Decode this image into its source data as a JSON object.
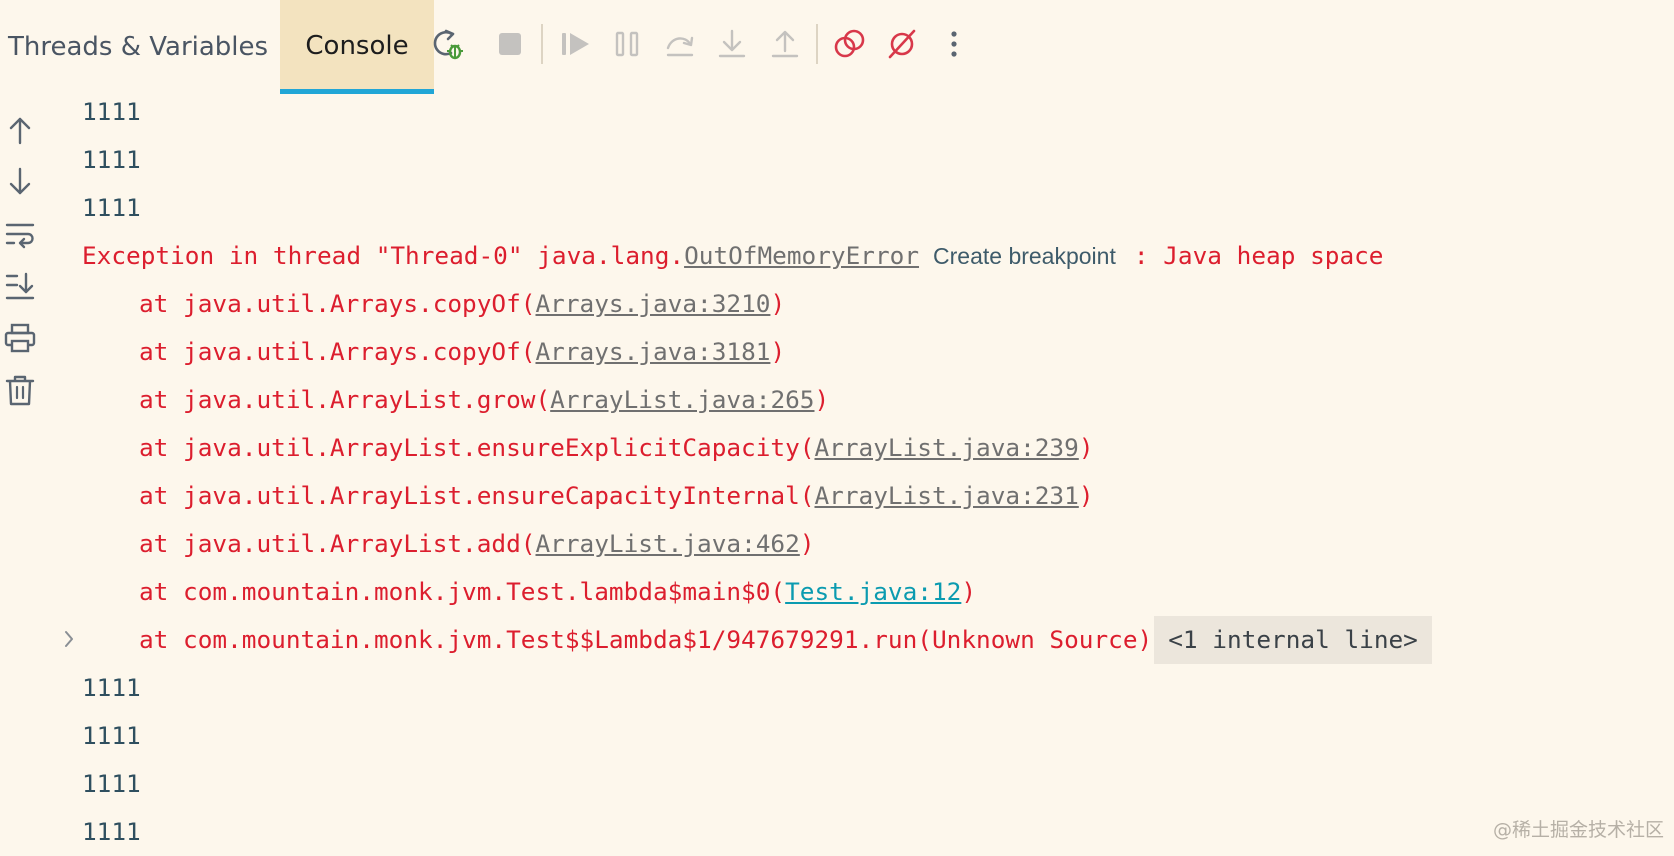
{
  "tabs": [
    {
      "label": "Threads & Variables",
      "active": false
    },
    {
      "label": "Console",
      "active": true
    }
  ],
  "toolbar_icons": [
    "rerun-debug-icon",
    "stop-icon",
    "resume-icon",
    "pause-icon",
    "step-over-icon",
    "step-into-icon",
    "step-out-icon",
    "view-breakpoints-icon",
    "mute-breakpoints-icon",
    "more-icon"
  ],
  "side_icons": [
    "arrow-up-icon",
    "arrow-down-icon",
    "soft-wrap-icon",
    "scroll-to-end-icon",
    "print-icon",
    "clear-all-icon"
  ],
  "colors": {
    "background": "#fdf7ec",
    "error_text": "#dc1e2e",
    "output_text": "#2f4f5f",
    "active_tab": "#f3e3bf",
    "active_tab_underline": "#21a6d6",
    "user_link": "#0b9bb0"
  },
  "console": {
    "lines_before": [
      "1111",
      "1111",
      "1111"
    ],
    "exception": {
      "prefix": "Exception in thread \"Thread-0\" java.lang.",
      "class_link": "OutOfMemoryError",
      "breakpoint_hint": "Create breakpoint",
      "suffix": ": Java heap space"
    },
    "stack": [
      {
        "text": "at java.util.Arrays.copyOf(",
        "link": "Arrays.java:3210",
        "close": ")"
      },
      {
        "text": "at java.util.Arrays.copyOf(",
        "link": "Arrays.java:3181",
        "close": ")"
      },
      {
        "text": "at java.util.ArrayList.grow(",
        "link": "ArrayList.java:265",
        "close": ")"
      },
      {
        "text": "at java.util.ArrayList.ensureExplicitCapacity(",
        "link": "ArrayList.java:239",
        "close": ")"
      },
      {
        "text": "at java.util.ArrayList.ensureCapacityInternal(",
        "link": "ArrayList.java:231",
        "close": ")"
      },
      {
        "text": "at java.util.ArrayList.add(",
        "link": "ArrayList.java:462",
        "close": ")"
      },
      {
        "text": "at com.mountain.monk.jvm.Test.lambda$main$0(",
        "link": "Test.java:12",
        "close": ")"
      }
    ],
    "last_frame": "at com.mountain.monk.jvm.Test$$Lambda$1/947679291.run(Unknown Source)",
    "internal_lines": "<1 internal line>",
    "lines_after": [
      "1111",
      "1111",
      "1111",
      "1111"
    ]
  },
  "watermark": "@稀土掘金技术社区"
}
